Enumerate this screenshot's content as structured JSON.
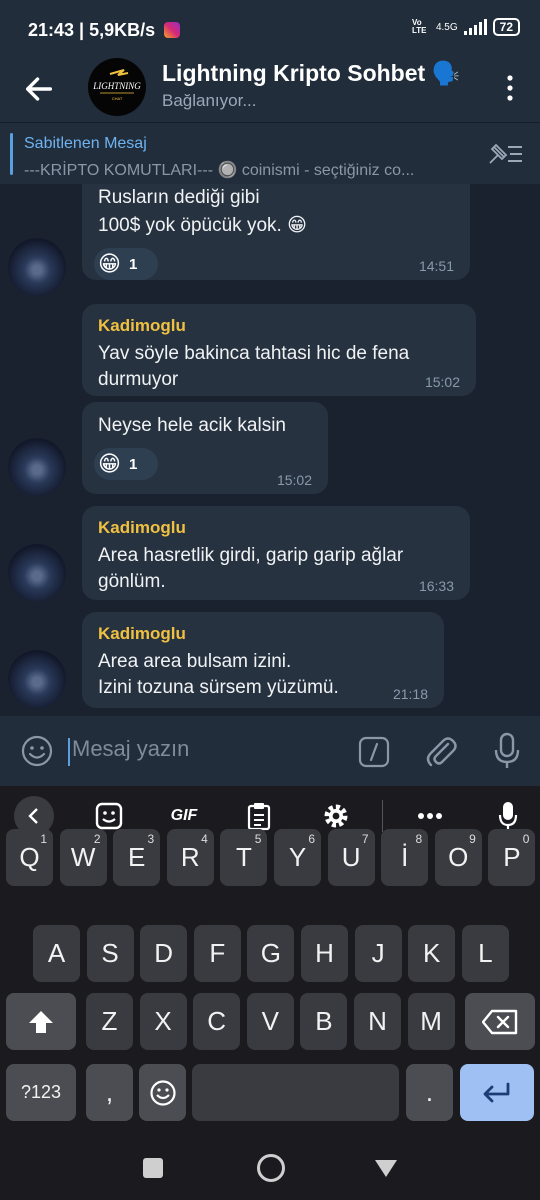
{
  "status_bar": {
    "time": "21:43",
    "speed": "5,9KB/s",
    "network": "4.5G",
    "volte": "Vo LTE",
    "battery": "72"
  },
  "header": {
    "title": "Lightning Kripto Sohbet 🗣️",
    "status": "Bağlanıyor...",
    "logo_text": "LIGHTNING",
    "logo_subtext": "CHAT"
  },
  "pinned": {
    "title": "Sabitlenen Mesaj",
    "text": "---KRİPTO KOMUTLARI--- 🔘 coinismi - seçtiğiniz co..."
  },
  "messages": [
    {
      "sender": "",
      "lines": [
        "Rusların dediği gibi",
        "100$ yok öpücük yok. 😁"
      ],
      "time": "14:51",
      "reaction": {
        "emoji": "😁",
        "count": "1"
      }
    },
    {
      "sender": "Kadimoglu",
      "lines": [
        "Yav söyle bakinca tahtasi hic de fena",
        "durmuyor"
      ],
      "time": "15:02",
      "reaction": null
    },
    {
      "sender": "",
      "lines": [
        "Neyse hele acik kalsin"
      ],
      "time": "15:02",
      "reaction": {
        "emoji": "😁",
        "count": "1"
      }
    },
    {
      "sender": "Kadimoglu",
      "lines": [
        "Area hasretlik girdi, garip garip ağlar",
        "gönlüm."
      ],
      "time": "16:33",
      "reaction": null
    },
    {
      "sender": "Kadimoglu",
      "lines": [
        "Area area bulsam izini.",
        "Izini tozuna sürsem yüzümü."
      ],
      "time": "21:18",
      "reaction": null
    }
  ],
  "input": {
    "placeholder": "Mesaj yazın"
  },
  "keyboard": {
    "toolbar": {
      "gif": "GIF"
    },
    "row1": [
      {
        "k": "Q",
        "h": "1"
      },
      {
        "k": "W",
        "h": "2"
      },
      {
        "k": "E",
        "h": "3"
      },
      {
        "k": "R",
        "h": "4"
      },
      {
        "k": "T",
        "h": "5"
      },
      {
        "k": "Y",
        "h": "6"
      },
      {
        "k": "U",
        "h": "7"
      },
      {
        "k": "İ",
        "h": "8"
      },
      {
        "k": "O",
        "h": "9"
      },
      {
        "k": "P",
        "h": "0"
      }
    ],
    "row2": [
      "A",
      "S",
      "D",
      "F",
      "G",
      "H",
      "J",
      "K",
      "L"
    ],
    "row3": [
      "Z",
      "X",
      "C",
      "V",
      "B",
      "N",
      "M"
    ],
    "symbols_key": "?123",
    "comma_key": ",",
    "period_key": "."
  }
}
